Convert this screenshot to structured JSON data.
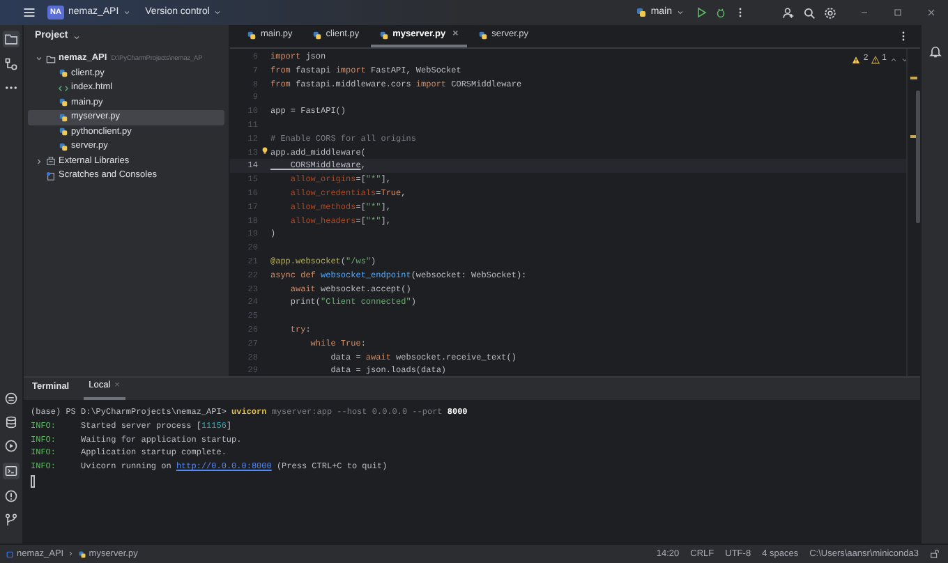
{
  "title_bar": {
    "project_badge": "NA",
    "project": "nemaz_API",
    "vcs": "Version control",
    "branch": "main"
  },
  "project_panel": {
    "title": "Project",
    "tree": [
      {
        "label": "nemaz_API",
        "kind": "folder",
        "note": "D:\\PyCharmProjects\\nemaz_AP",
        "expanded": true,
        "selected": false,
        "children": [
          {
            "label": "client.py",
            "kind": "python",
            "selected": false
          },
          {
            "label": "index.html",
            "kind": "html",
            "selected": false
          },
          {
            "label": "main.py",
            "kind": "python",
            "selected": false
          },
          {
            "label": "myserver.py",
            "kind": "python",
            "selected": true
          },
          {
            "label": "pythonclient.py",
            "kind": "python",
            "selected": false
          },
          {
            "label": "server.py",
            "kind": "python",
            "selected": false
          }
        ]
      },
      {
        "label": "External Libraries",
        "kind": "library",
        "expanded": false,
        "selected": false
      },
      {
        "label": "Scratches and Consoles",
        "kind": "scratches",
        "selected": false
      }
    ]
  },
  "editor": {
    "tabs": [
      {
        "label": "main.py",
        "selected": false
      },
      {
        "label": "client.py",
        "selected": false
      },
      {
        "label": "myserver.py",
        "selected": true
      },
      {
        "label": "server.py",
        "selected": false
      }
    ],
    "close_tab": "×",
    "warnings": "2",
    "weak_warnings": "1",
    "lines": [
      {
        "number": "6",
        "current": false,
        "tokens": [
          {
            "text": "import",
            "kind": "kw"
          },
          {
            "text": " json",
            "kind": "plain"
          }
        ]
      },
      {
        "number": "7",
        "current": false,
        "tokens": [
          {
            "text": "from",
            "kind": "kw"
          },
          {
            "text": " fastapi ",
            "kind": "plain"
          },
          {
            "text": "import",
            "kind": "kw"
          },
          {
            "text": " FastAPI, WebSocket",
            "kind": "plain"
          }
        ]
      },
      {
        "number": "8",
        "current": false,
        "tokens": [
          {
            "text": "from",
            "kind": "kw"
          },
          {
            "text": " fastapi.middleware.cors ",
            "kind": "plain"
          },
          {
            "text": "import",
            "kind": "kw"
          },
          {
            "text": " CORSMiddleware",
            "kind": "plain"
          }
        ]
      },
      {
        "number": "9",
        "current": false
      },
      {
        "number": "10",
        "current": false,
        "tokens": [
          {
            "text": "app = FastAPI()",
            "kind": "plain"
          }
        ]
      },
      {
        "number": "11",
        "current": false
      },
      {
        "number": "12",
        "current": false,
        "tokens": [
          {
            "text": "# Enable CORS for all origins",
            "kind": "comment"
          }
        ]
      },
      {
        "number": "13",
        "current": false,
        "tokens": [
          {
            "text": "app.add_middleware(",
            "kind": "plain"
          }
        ]
      },
      {
        "number": "14",
        "current": true,
        "tokens": [
          {
            "text": "    CORSMiddleware",
            "kind": "underline"
          },
          {
            "text": ",",
            "kind": "plain"
          }
        ]
      },
      {
        "number": "15",
        "current": false,
        "tokens": [
          {
            "text": "    allow_origins",
            "kind": "param"
          },
          {
            "text": "=[",
            "kind": "plain"
          },
          {
            "text": "\"*\"",
            "kind": "str"
          },
          {
            "text": "],",
            "kind": "plain"
          }
        ]
      },
      {
        "number": "16",
        "current": false,
        "tokens": [
          {
            "text": "    allow_credentials",
            "kind": "param"
          },
          {
            "text": "=",
            "kind": "plain"
          },
          {
            "text": "True",
            "kind": "kw"
          },
          {
            "text": ",",
            "kind": "plain"
          }
        ]
      },
      {
        "number": "17",
        "current": false,
        "tokens": [
          {
            "text": "    allow_methods",
            "kind": "param"
          },
          {
            "text": "=[",
            "kind": "plain"
          },
          {
            "text": "\"*\"",
            "kind": "str"
          },
          {
            "text": "],",
            "kind": "plain"
          }
        ]
      },
      {
        "number": "18",
        "current": false,
        "tokens": [
          {
            "text": "    allow_headers",
            "kind": "param"
          },
          {
            "text": "=[",
            "kind": "plain"
          },
          {
            "text": "\"*\"",
            "kind": "str"
          },
          {
            "text": "],",
            "kind": "plain"
          }
        ]
      },
      {
        "number": "19",
        "current": false,
        "tokens": [
          {
            "text": ")",
            "kind": "plain"
          }
        ]
      },
      {
        "number": "20",
        "current": false
      },
      {
        "number": "21",
        "current": false,
        "tokens": [
          {
            "text": "@app.websocket",
            "kind": "deco"
          },
          {
            "text": "(",
            "kind": "plain"
          },
          {
            "text": "\"/ws\"",
            "kind": "str"
          },
          {
            "text": ")",
            "kind": "plain"
          }
        ]
      },
      {
        "number": "22",
        "current": false,
        "tokens": [
          {
            "text": "async def ",
            "kind": "kw"
          },
          {
            "text": "websocket_endpoint",
            "kind": "func"
          },
          {
            "text": "(websocket: WebSocket):",
            "kind": "plain"
          }
        ]
      },
      {
        "number": "23",
        "current": false,
        "tokens": [
          {
            "text": "    await",
            "kind": "kw"
          },
          {
            "text": " websocket.accept()",
            "kind": "plain"
          }
        ]
      },
      {
        "number": "24",
        "current": false,
        "tokens": [
          {
            "text": "    print(",
            "kind": "plain"
          },
          {
            "text": "\"Client connected\"",
            "kind": "str"
          },
          {
            "text": ")",
            "kind": "plain"
          }
        ]
      },
      {
        "number": "25",
        "current": false
      },
      {
        "number": "26",
        "current": false,
        "tokens": [
          {
            "text": "    try",
            "kind": "kw"
          },
          {
            "text": ":",
            "kind": "plain"
          }
        ]
      },
      {
        "number": "27",
        "current": false,
        "tokens": [
          {
            "text": "        while True",
            "kind": "kw"
          },
          {
            "text": ":",
            "kind": "plain"
          }
        ]
      },
      {
        "number": "28",
        "current": false,
        "tokens": [
          {
            "text": "            data = ",
            "kind": "plain"
          },
          {
            "text": "await",
            "kind": "kw"
          },
          {
            "text": " websocket.receive_text()",
            "kind": "plain"
          }
        ]
      },
      {
        "number": "29",
        "current": false,
        "tokens": [
          {
            "text": "            data = json.loads(data)",
            "kind": "plain"
          }
        ]
      }
    ]
  },
  "terminal": {
    "title": "Terminal",
    "tabs": [
      {
        "label": "Local",
        "selected": true
      }
    ],
    "close_tab": "×",
    "lines": [
      {
        "tokens": [
          {
            "text": "(base) PS D:\\PyCharmProjects\\nemaz_API> ",
            "kind": "plain"
          },
          {
            "text": "uvicorn",
            "kind": "cmd"
          },
          {
            "text": " myserver:app --host 0.0.0.0 --port ",
            "kind": "dim"
          },
          {
            "text": "8000",
            "kind": "bold"
          }
        ]
      },
      {
        "tokens": [
          {
            "text": "INFO:",
            "kind": "info"
          },
          {
            "text": "     Started server process [",
            "kind": "plain"
          },
          {
            "text": "11156",
            "kind": "num"
          },
          {
            "text": "]",
            "kind": "plain"
          }
        ]
      },
      {
        "tokens": [
          {
            "text": "INFO:",
            "kind": "info"
          },
          {
            "text": "     Waiting for application startup.",
            "kind": "plain"
          }
        ]
      },
      {
        "tokens": [
          {
            "text": "INFO:",
            "kind": "info"
          },
          {
            "text": "     Application startup complete.",
            "kind": "plain"
          }
        ]
      },
      {
        "tokens": [
          {
            "text": "INFO:",
            "kind": "info"
          },
          {
            "text": "     Uvicorn running on ",
            "kind": "plain"
          },
          {
            "text": "http://0.0.0.0:8000",
            "kind": "link"
          },
          {
            "text": " (Press CTRL+C to quit)",
            "kind": "plain"
          }
        ]
      }
    ]
  },
  "status_bar": {
    "breadcrumbs": [
      "nemaz_API",
      "myserver.py"
    ],
    "separator": "›",
    "items": [
      "14:20",
      "CRLF",
      "UTF-8",
      "4 spaces",
      "C:\\Users\\aansr\\miniconda3"
    ]
  }
}
